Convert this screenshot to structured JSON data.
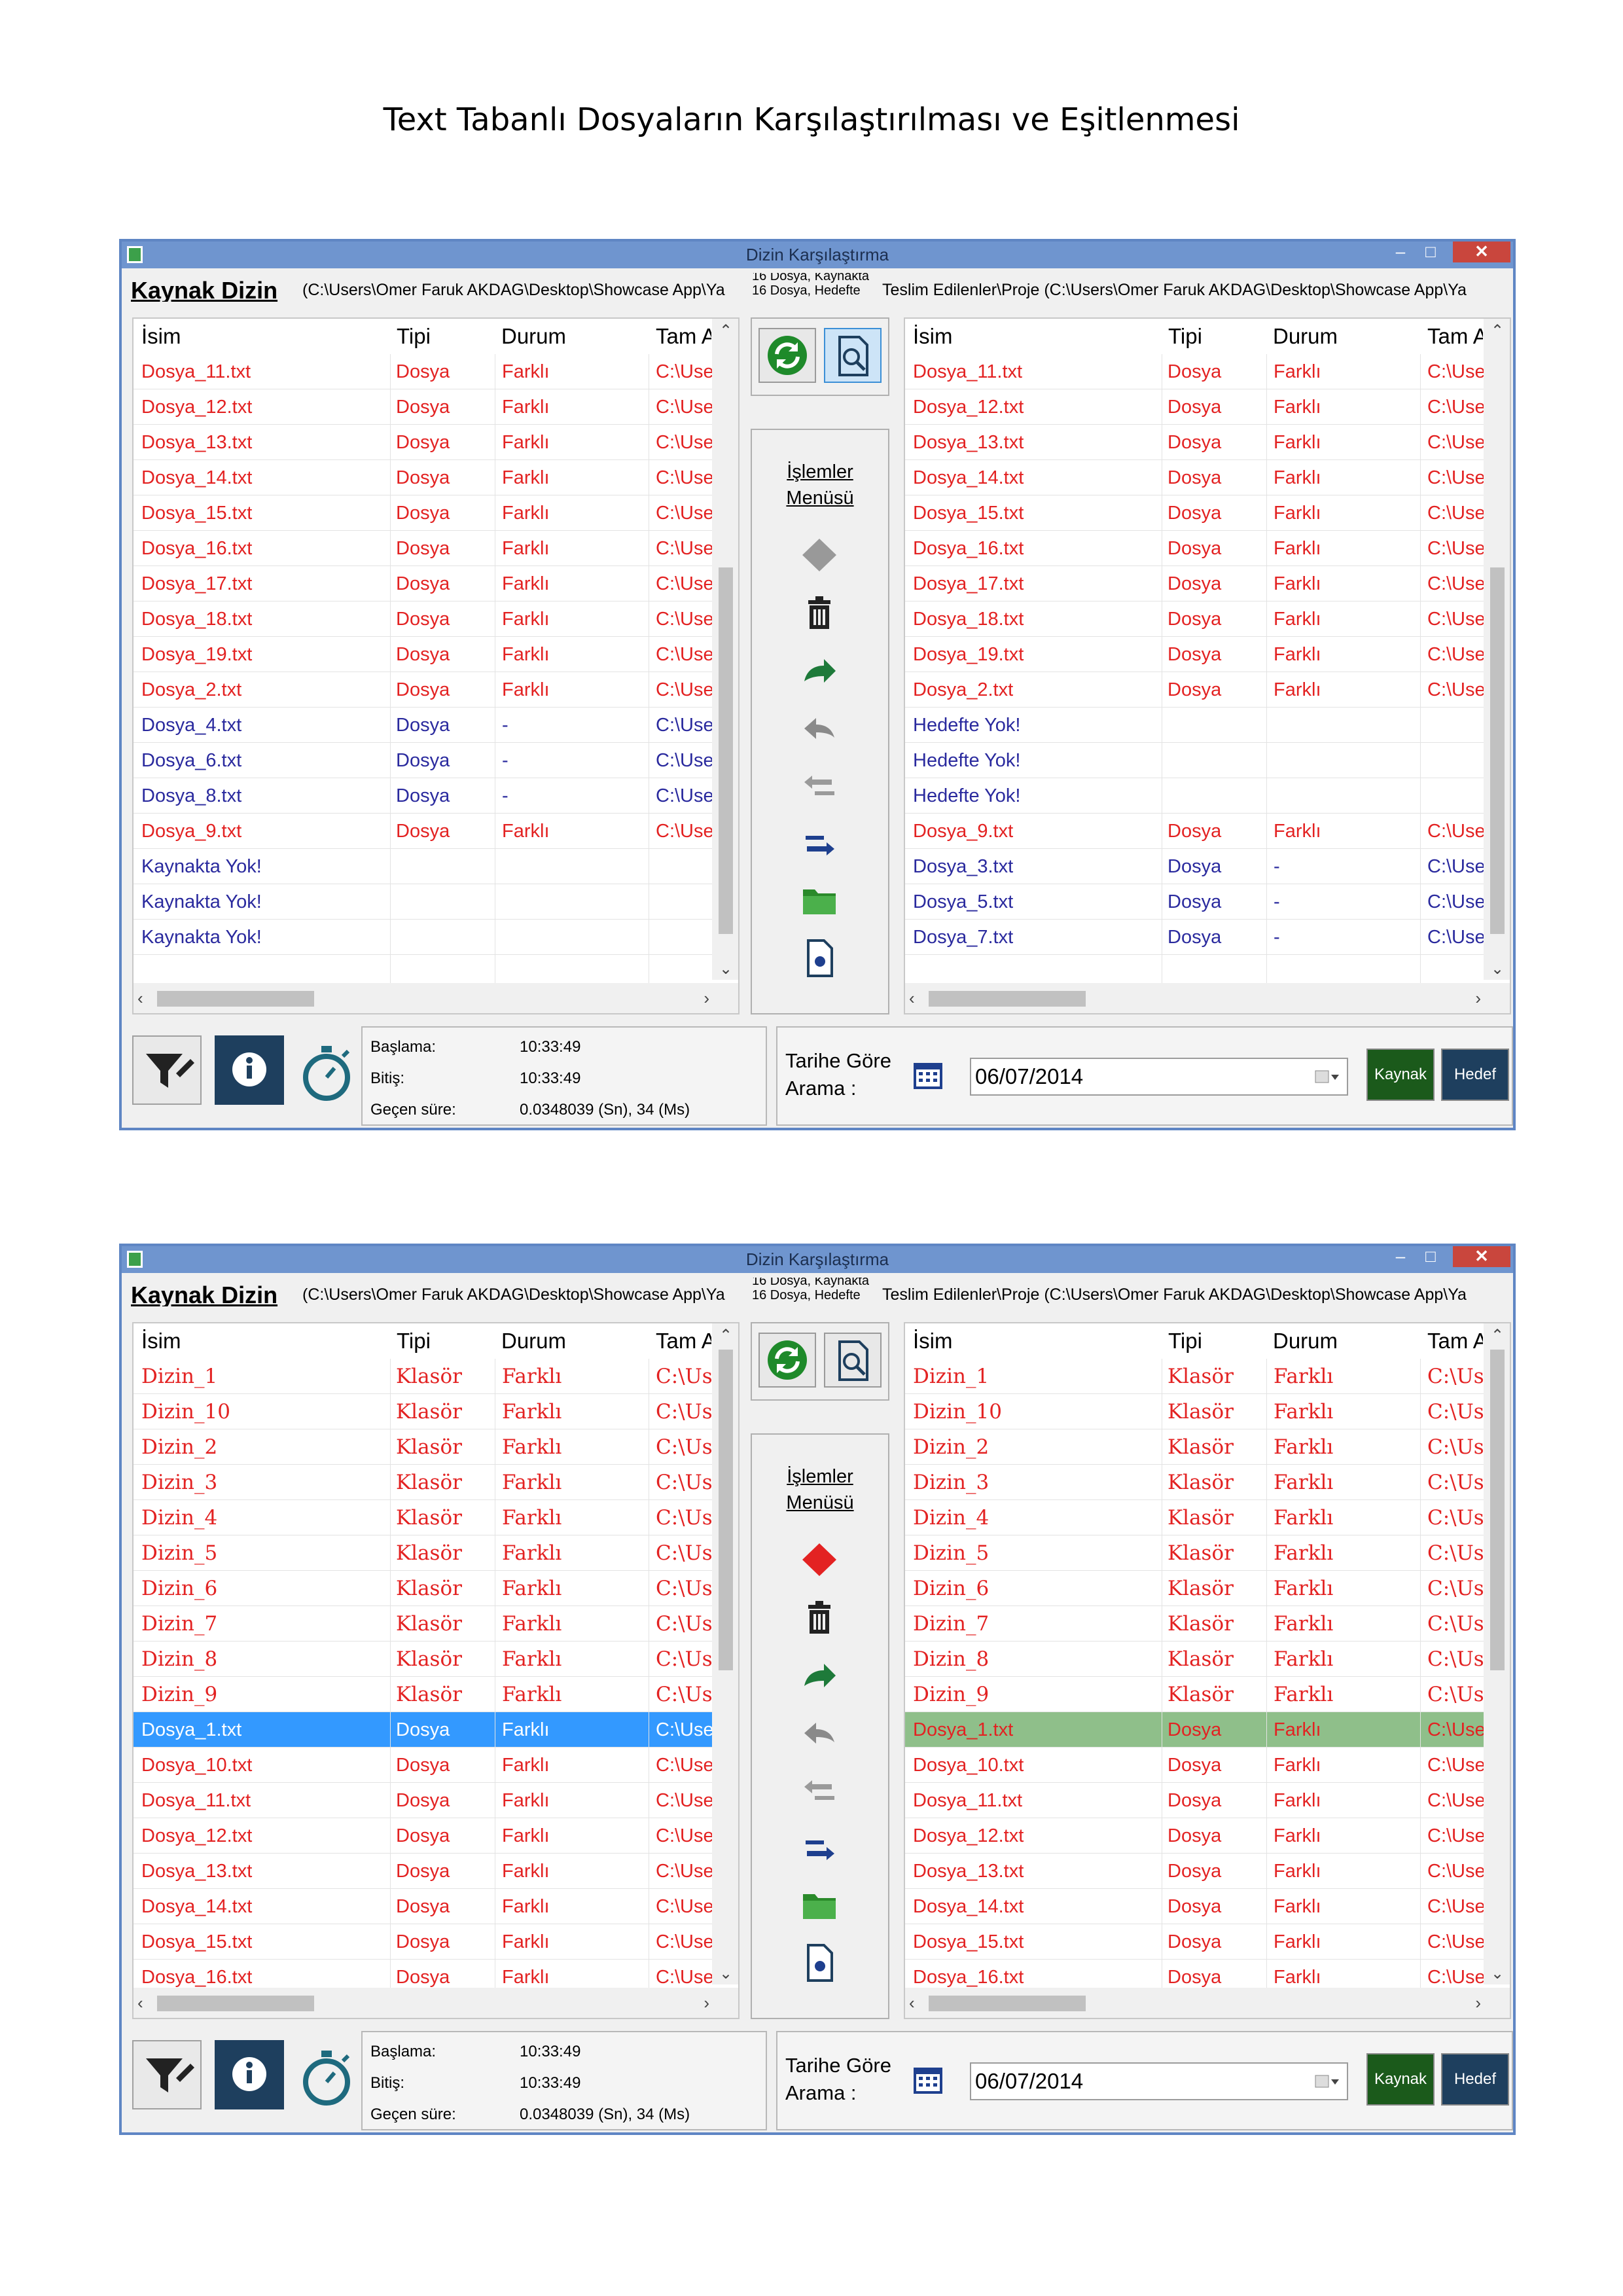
{
  "document": {
    "title": "Text Tabanlı Dosyaların Karşılaştırılması ve Eşitlenmesi"
  },
  "window": {
    "title": "Dizin Karşılaştırma",
    "min_label": "–",
    "max_label": "□",
    "close_label": "✕",
    "kaynak_label": "Kaynak Dizin",
    "left_path": "(C:\\Users\\Omer Faruk AKDAG\\Desktop\\Showcase App\\Ya",
    "count_source": "16 Dosya, Kaynakta",
    "count_target": "16 Dosya, Hedefte",
    "right_path": "Teslim Edilenler\\Proje  (C:\\Users\\Omer Faruk AKDAG\\Desktop\\Showcase App\\Ya",
    "columns": {
      "name": "İsim",
      "type": "Tipi",
      "status": "Durum",
      "path": "Tam A"
    },
    "ops_label": "İşlemler Menüsü",
    "time": {
      "start_label": "Başlama:",
      "start_value": "10:33:49",
      "end_label": "Bitiş:",
      "end_value": "10:33:49",
      "elapsed_label": "Geçen süre:",
      "elapsed_value": "0.0348039 (Sn), 34 (Ms)"
    },
    "date_search_label": "Tarihe Göre Arama :",
    "date_value": "06/07/2014",
    "kaynak_button": "Kaynak",
    "hedef_button": "Hedef"
  },
  "screens": [
    {
      "left_rows": [
        {
          "name": "Dosya_11.txt",
          "type": "Dosya",
          "status": "Farklı",
          "path": "C:\\Use",
          "kind": "diff"
        },
        {
          "name": "Dosya_12.txt",
          "type": "Dosya",
          "status": "Farklı",
          "path": "C:\\Use",
          "kind": "diff"
        },
        {
          "name": "Dosya_13.txt",
          "type": "Dosya",
          "status": "Farklı",
          "path": "C:\\Use",
          "kind": "diff"
        },
        {
          "name": "Dosya_14.txt",
          "type": "Dosya",
          "status": "Farklı",
          "path": "C:\\Use",
          "kind": "diff"
        },
        {
          "name": "Dosya_15.txt",
          "type": "Dosya",
          "status": "Farklı",
          "path": "C:\\Use",
          "kind": "diff"
        },
        {
          "name": "Dosya_16.txt",
          "type": "Dosya",
          "status": "Farklı",
          "path": "C:\\Use",
          "kind": "diff"
        },
        {
          "name": "Dosya_17.txt",
          "type": "Dosya",
          "status": "Farklı",
          "path": "C:\\Use",
          "kind": "diff"
        },
        {
          "name": "Dosya_18.txt",
          "type": "Dosya",
          "status": "Farklı",
          "path": "C:\\Use",
          "kind": "diff"
        },
        {
          "name": "Dosya_19.txt",
          "type": "Dosya",
          "status": "Farklı",
          "path": "C:\\Use",
          "kind": "diff"
        },
        {
          "name": "Dosya_2.txt",
          "type": "Dosya",
          "status": "Farklı",
          "path": "C:\\Use",
          "kind": "diff"
        },
        {
          "name": "Dosya_4.txt",
          "type": "Dosya",
          "status": "-",
          "path": "C:\\Use",
          "kind": "same"
        },
        {
          "name": "Dosya_6.txt",
          "type": "Dosya",
          "status": "-",
          "path": "C:\\Use",
          "kind": "same"
        },
        {
          "name": "Dosya_8.txt",
          "type": "Dosya",
          "status": "-",
          "path": "C:\\Use",
          "kind": "same"
        },
        {
          "name": "Dosya_9.txt",
          "type": "Dosya",
          "status": "Farklı",
          "path": "C:\\Use",
          "kind": "diff"
        },
        {
          "name": "Kaynakta Yok!",
          "type": "",
          "status": "",
          "path": "",
          "kind": "miss"
        },
        {
          "name": "Kaynakta Yok!",
          "type": "",
          "status": "",
          "path": "",
          "kind": "miss"
        },
        {
          "name": "Kaynakta Yok!",
          "type": "",
          "status": "",
          "path": "",
          "kind": "miss"
        },
        {
          "name": "",
          "type": "",
          "status": "",
          "path": "",
          "kind": "same"
        }
      ],
      "right_rows": [
        {
          "name": "Dosya_11.txt",
          "type": "Dosya",
          "status": "Farklı",
          "path": "C:\\Use",
          "kind": "diff"
        },
        {
          "name": "Dosya_12.txt",
          "type": "Dosya",
          "status": "Farklı",
          "path": "C:\\Use",
          "kind": "diff"
        },
        {
          "name": "Dosya_13.txt",
          "type": "Dosya",
          "status": "Farklı",
          "path": "C:\\Use",
          "kind": "diff"
        },
        {
          "name": "Dosya_14.txt",
          "type": "Dosya",
          "status": "Farklı",
          "path": "C:\\Use",
          "kind": "diff"
        },
        {
          "name": "Dosya_15.txt",
          "type": "Dosya",
          "status": "Farklı",
          "path": "C:\\Use",
          "kind": "diff"
        },
        {
          "name": "Dosya_16.txt",
          "type": "Dosya",
          "status": "Farklı",
          "path": "C:\\Use",
          "kind": "diff"
        },
        {
          "name": "Dosya_17.txt",
          "type": "Dosya",
          "status": "Farklı",
          "path": "C:\\Use",
          "kind": "diff"
        },
        {
          "name": "Dosya_18.txt",
          "type": "Dosya",
          "status": "Farklı",
          "path": "C:\\Use",
          "kind": "diff"
        },
        {
          "name": "Dosya_19.txt",
          "type": "Dosya",
          "status": "Farklı",
          "path": "C:\\Use",
          "kind": "diff"
        },
        {
          "name": "Dosya_2.txt",
          "type": "Dosya",
          "status": "Farklı",
          "path": "C:\\Use",
          "kind": "diff"
        },
        {
          "name": "Hedefte Yok!",
          "type": "",
          "status": "",
          "path": "",
          "kind": "miss"
        },
        {
          "name": "Hedefte Yok!",
          "type": "",
          "status": "",
          "path": "",
          "kind": "miss"
        },
        {
          "name": "Hedefte Yok!",
          "type": "",
          "status": "",
          "path": "",
          "kind": "miss"
        },
        {
          "name": "Dosya_9.txt",
          "type": "Dosya",
          "status": "Farklı",
          "path": "C:\\Use",
          "kind": "diff"
        },
        {
          "name": "Dosya_3.txt",
          "type": "Dosya",
          "status": "-",
          "path": "C:\\Use",
          "kind": "same"
        },
        {
          "name": "Dosya_5.txt",
          "type": "Dosya",
          "status": "-",
          "path": "C:\\Use",
          "kind": "same"
        },
        {
          "name": "Dosya_7.txt",
          "type": "Dosya",
          "status": "-",
          "path": "C:\\Use",
          "kind": "same"
        },
        {
          "name": "",
          "type": "",
          "status": "",
          "path": "",
          "kind": "same"
        }
      ]
    },
    {
      "left_rows": [
        {
          "name": "Dizin_1",
          "type": "Klasör",
          "status": "Farklı",
          "path": "C:\\Us",
          "kind": "dir"
        },
        {
          "name": "Dizin_10",
          "type": "Klasör",
          "status": "Farklı",
          "path": "C:\\Us",
          "kind": "dir"
        },
        {
          "name": "Dizin_2",
          "type": "Klasör",
          "status": "Farklı",
          "path": "C:\\Us",
          "kind": "dir"
        },
        {
          "name": "Dizin_3",
          "type": "Klasör",
          "status": "Farklı",
          "path": "C:\\Us",
          "kind": "dir"
        },
        {
          "name": "Dizin_4",
          "type": "Klasör",
          "status": "Farklı",
          "path": "C:\\Us",
          "kind": "dir"
        },
        {
          "name": "Dizin_5",
          "type": "Klasör",
          "status": "Farklı",
          "path": "C:\\Us",
          "kind": "dir"
        },
        {
          "name": "Dizin_6",
          "type": "Klasör",
          "status": "Farklı",
          "path": "C:\\Us",
          "kind": "dir"
        },
        {
          "name": "Dizin_7",
          "type": "Klasör",
          "status": "Farklı",
          "path": "C:\\Us",
          "kind": "dir"
        },
        {
          "name": "Dizin_8",
          "type": "Klasör",
          "status": "Farklı",
          "path": "C:\\Us",
          "kind": "dir"
        },
        {
          "name": "Dizin_9",
          "type": "Klasör",
          "status": "Farklı",
          "path": "C:\\Us",
          "kind": "dir"
        },
        {
          "name": "Dosya_1.txt",
          "type": "Dosya",
          "status": "Farklı",
          "path": "C:\\Use",
          "kind": "sel-blue"
        },
        {
          "name": "Dosya_10.txt",
          "type": "Dosya",
          "status": "Farklı",
          "path": "C:\\Use",
          "kind": "diff"
        },
        {
          "name": "Dosya_11.txt",
          "type": "Dosya",
          "status": "Farklı",
          "path": "C:\\Use",
          "kind": "diff"
        },
        {
          "name": "Dosya_12.txt",
          "type": "Dosya",
          "status": "Farklı",
          "path": "C:\\Use",
          "kind": "diff"
        },
        {
          "name": "Dosya_13.txt",
          "type": "Dosya",
          "status": "Farklı",
          "path": "C:\\Use",
          "kind": "diff"
        },
        {
          "name": "Dosya_14.txt",
          "type": "Dosya",
          "status": "Farklı",
          "path": "C:\\Use",
          "kind": "diff"
        },
        {
          "name": "Dosya_15.txt",
          "type": "Dosya",
          "status": "Farklı",
          "path": "C:\\Use",
          "kind": "diff"
        },
        {
          "name": "Dosya_16.txt",
          "type": "Dosya",
          "status": "Farklı",
          "path": "C:\\Use",
          "kind": "diff"
        }
      ],
      "right_rows": [
        {
          "name": "Dizin_1",
          "type": "Klasör",
          "status": "Farklı",
          "path": "C:\\Us",
          "kind": "dir"
        },
        {
          "name": "Dizin_10",
          "type": "Klasör",
          "status": "Farklı",
          "path": "C:\\Us",
          "kind": "dir"
        },
        {
          "name": "Dizin_2",
          "type": "Klasör",
          "status": "Farklı",
          "path": "C:\\Us",
          "kind": "dir"
        },
        {
          "name": "Dizin_3",
          "type": "Klasör",
          "status": "Farklı",
          "path": "C:\\Us",
          "kind": "dir"
        },
        {
          "name": "Dizin_4",
          "type": "Klasör",
          "status": "Farklı",
          "path": "C:\\Us",
          "kind": "dir"
        },
        {
          "name": "Dizin_5",
          "type": "Klasör",
          "status": "Farklı",
          "path": "C:\\Us",
          "kind": "dir"
        },
        {
          "name": "Dizin_6",
          "type": "Klasör",
          "status": "Farklı",
          "path": "C:\\Us",
          "kind": "dir"
        },
        {
          "name": "Dizin_7",
          "type": "Klasör",
          "status": "Farklı",
          "path": "C:\\Us",
          "kind": "dir"
        },
        {
          "name": "Dizin_8",
          "type": "Klasör",
          "status": "Farklı",
          "path": "C:\\Us",
          "kind": "dir"
        },
        {
          "name": "Dizin_9",
          "type": "Klasör",
          "status": "Farklı",
          "path": "C:\\Us",
          "kind": "dir"
        },
        {
          "name": "Dosya_1.txt",
          "type": "Dosya",
          "status": "Farklı",
          "path": "C:\\Use",
          "kind": "sel-green"
        },
        {
          "name": "Dosya_10.txt",
          "type": "Dosya",
          "status": "Farklı",
          "path": "C:\\Use",
          "kind": "diff"
        },
        {
          "name": "Dosya_11.txt",
          "type": "Dosya",
          "status": "Farklı",
          "path": "C:\\Use",
          "kind": "diff"
        },
        {
          "name": "Dosya_12.txt",
          "type": "Dosya",
          "status": "Farklı",
          "path": "C:\\Use",
          "kind": "diff"
        },
        {
          "name": "Dosya_13.txt",
          "type": "Dosya",
          "status": "Farklı",
          "path": "C:\\Use",
          "kind": "diff"
        },
        {
          "name": "Dosya_14.txt",
          "type": "Dosya",
          "status": "Farklı",
          "path": "C:\\Use",
          "kind": "diff"
        },
        {
          "name": "Dosya_15.txt",
          "type": "Dosya",
          "status": "Farklı",
          "path": "C:\\Use",
          "kind": "diff"
        },
        {
          "name": "Dosya_16.txt",
          "type": "Dosya",
          "status": "Farklı",
          "path": "C:\\Use",
          "kind": "diff"
        }
      ]
    }
  ],
  "colors": {
    "accent": "#6f95cf",
    "diff": "#e32222",
    "missing": "#2a2a9e",
    "selected_source": "#3399ff",
    "selected_target": "#8fbf8a",
    "kaynak_button": "#1b5a1b",
    "hedef_button": "#1e3f5e"
  },
  "icons": [
    "refresh-icon",
    "search-document-icon",
    "diamond-icon",
    "trash-icon",
    "forward-arrow-icon",
    "back-arrow-icon",
    "copy-left-icon",
    "copy-right-icon",
    "folder-icon",
    "document-icon",
    "filter-icon",
    "info-icon",
    "stopwatch-icon",
    "calendar-icon"
  ]
}
